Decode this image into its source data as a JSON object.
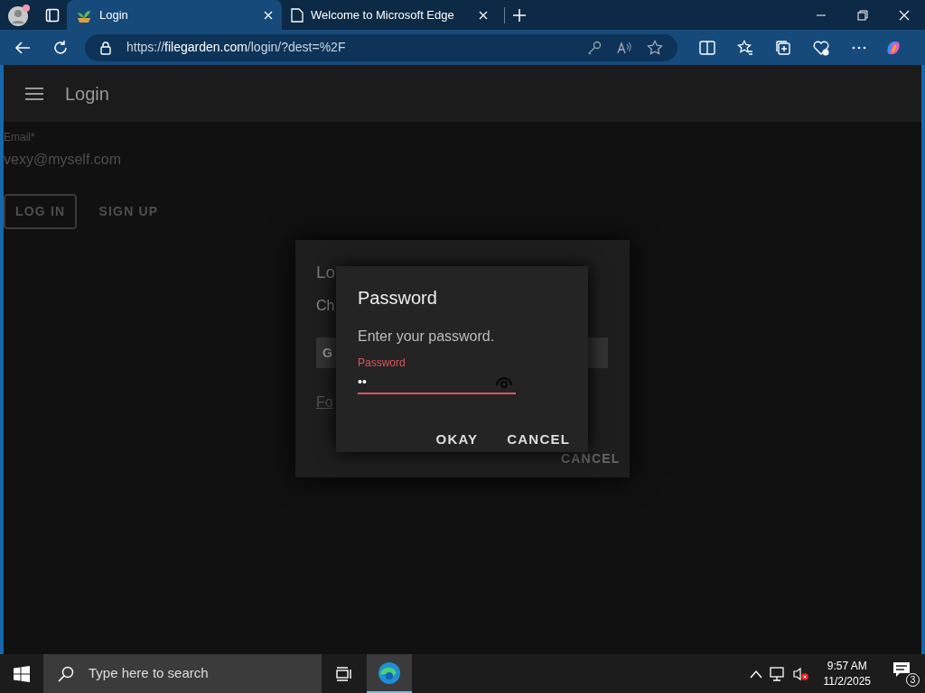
{
  "browser": {
    "tabs": [
      {
        "title": "Login",
        "selected": true
      },
      {
        "title": "Welcome to Microsoft Edge",
        "selected": false
      }
    ],
    "url": {
      "prefix": "https://",
      "domain": "filegarden.com",
      "path": "/login/?dest=%2F"
    }
  },
  "app_bar": {
    "title": "Login"
  },
  "form": {
    "email": {
      "label": "Email*",
      "value": "vexy@myself.com"
    },
    "buttons": [
      {
        "label": "LOG IN",
        "kind": "outlined"
      },
      {
        "label": "SIGN UP",
        "kind": "text"
      }
    ]
  },
  "back_dialog": {
    "title": "Lo",
    "text": "Ch",
    "button": "G",
    "link": "Fo",
    "cancel": "CANCEL"
  },
  "password_dialog": {
    "title": "Password",
    "text": "Enter your password.",
    "field": {
      "label": "Password",
      "value": "••",
      "error": true
    },
    "buttons": [
      "OKAY",
      "CANCEL"
    ]
  },
  "taskbar": {
    "search_placeholder": "Type here to search",
    "time": "9:57 AM",
    "date": "11/2/2025",
    "notifications": "3"
  }
}
